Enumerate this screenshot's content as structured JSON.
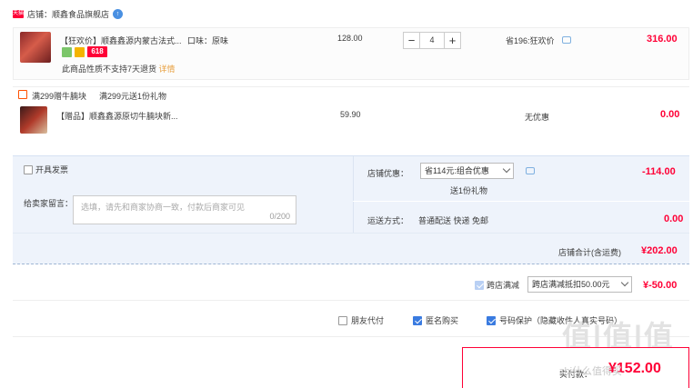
{
  "store": {
    "badge": "天猫",
    "name": "店铺：顺鑫食品旗舰店",
    "chat_badge": "↑"
  },
  "item1": {
    "title": "【狂欢价】顺鑫鑫源内蒙古法式...",
    "attr": "口味：原味",
    "promo_tag": "618",
    "notice": "此商品性质不支持7天退货",
    "notice_link": "详情",
    "unit_price": "128.00",
    "qty": "4",
    "minus": "−",
    "plus": "+",
    "discount": "省196:狂欢价",
    "total": "316.00"
  },
  "gift": {
    "rule1": "满299赠牛腩块",
    "rule2": "满299元送1份礼物",
    "title": "【赠品】顺鑫鑫源原切牛腩块新...",
    "price": "59.90",
    "discount": "无优惠",
    "total": "0.00"
  },
  "options": {
    "invoice_label": "开具发票",
    "message_label": "给卖家留言：",
    "message_placeholder": "选填，请先和商家协商一致，付款后商家可见",
    "message_counter": "0/200",
    "store_promo_label": "店铺优惠：",
    "store_promo_value": "省114元:组合优惠",
    "store_promo_amount": "-114.00",
    "store_promo_sub": "送1份礼物",
    "shipping_label": "运送方式：",
    "shipping_value": "普通配送 快递 免邮",
    "shipping_amount": "0.00"
  },
  "store_total": {
    "label": "店铺合计(含运费)",
    "amount": "¥202.00"
  },
  "cross_store": {
    "label": "跨店满减",
    "select": "跨店满减抵扣50.00元",
    "amount": "¥-50.00"
  },
  "checks": {
    "friend_pay": "朋友代付",
    "anonymous": "匿名购买",
    "privacy": "号码保护（隐藏收件人真实号码）"
  },
  "pay": {
    "label": "实付款：",
    "amount": "¥152.00"
  },
  "watermark": {
    "big": "值|值|值",
    "small": "zhi什么值得买"
  },
  "colors": {
    "accent": "#ff0036",
    "panel": "#eef3fb",
    "check": "#3a7be0"
  }
}
